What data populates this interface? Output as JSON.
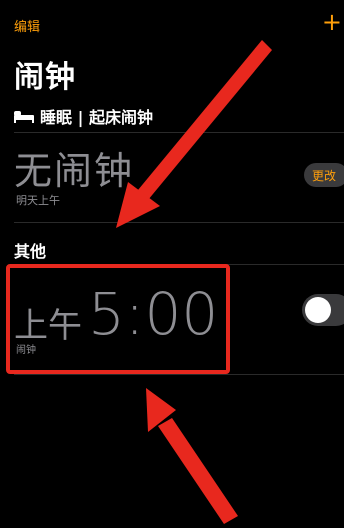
{
  "nav": {
    "edit_label": "编辑",
    "add_label": "+"
  },
  "title": "闹钟",
  "sleep": {
    "header": "睡眠 | 起床闹钟",
    "status": "无闹钟",
    "sub": "明天上午",
    "change_label": "更改"
  },
  "other_section": {
    "header": "其他"
  },
  "alarms": [
    {
      "ampm": "上午",
      "time": "5:00",
      "label": "闹钟",
      "enabled": false
    }
  ],
  "colors": {
    "accent": "#ff9f0a",
    "annotation": "#e8281e"
  },
  "icons": {
    "sleep": "bed-icon",
    "toggle": "toggle-switch"
  }
}
